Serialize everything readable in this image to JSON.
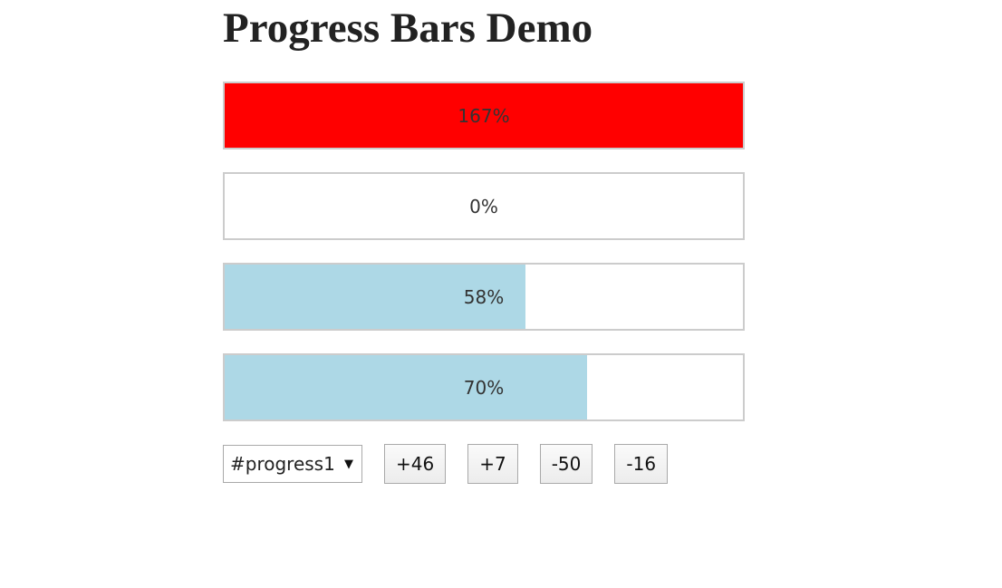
{
  "page": {
    "title": "Progress Bars Demo"
  },
  "bars": [
    {
      "label": "167%",
      "value": 167,
      "status": "over",
      "color": "#ff0000"
    },
    {
      "label": "0%",
      "value": 0,
      "status": "normal",
      "color": "#add8e6"
    },
    {
      "label": "58%",
      "value": 58,
      "status": "normal",
      "color": "#add8e6"
    },
    {
      "label": "70%",
      "value": 70,
      "status": "normal",
      "color": "#add8e6"
    }
  ],
  "controls": {
    "selected_bar": "#progress1",
    "select_arrow_icon": "caret-down-icon",
    "buttons": [
      "+46",
      "+7",
      "-50",
      "-16"
    ]
  },
  "colors": {
    "fill": "#add8e6",
    "over_limit": "#ff0000",
    "border": "#cccccc"
  }
}
